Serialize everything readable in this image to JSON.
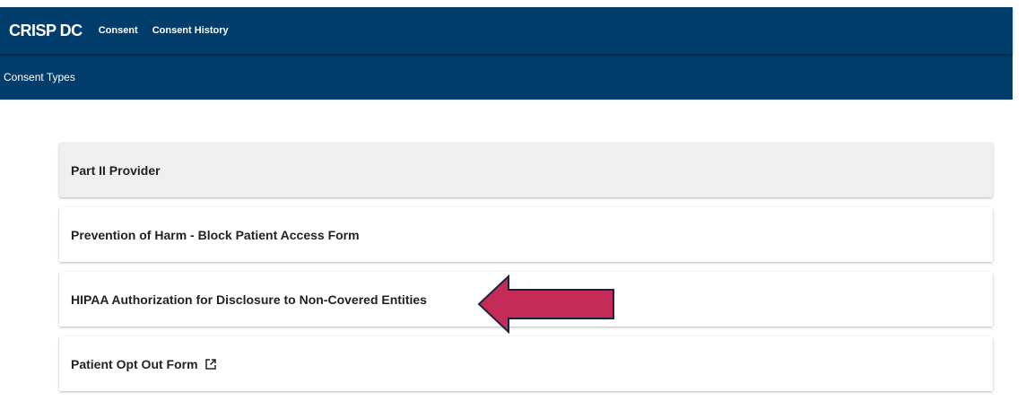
{
  "header": {
    "brand": "CRISP DC",
    "nav": [
      {
        "label": "Consent"
      },
      {
        "label": "Consent History"
      }
    ]
  },
  "subheader": {
    "title": "Consent Types"
  },
  "consent_types": [
    {
      "label": "Part II Provider"
    },
    {
      "label": "Prevention of Harm - Block Patient Access Form"
    },
    {
      "label": "HIPAA Authorization for Disclosure to Non-Covered Entities"
    },
    {
      "label": "Patient Opt Out Form",
      "icon": "external-link-icon"
    }
  ],
  "annotation": {
    "icon": "left-arrow-annotation",
    "fill_color": "#c62a56",
    "stroke_color": "#1a2340"
  },
  "colors": {
    "header_bg": "#003d6b",
    "selected_card_bg": "#efefef"
  }
}
